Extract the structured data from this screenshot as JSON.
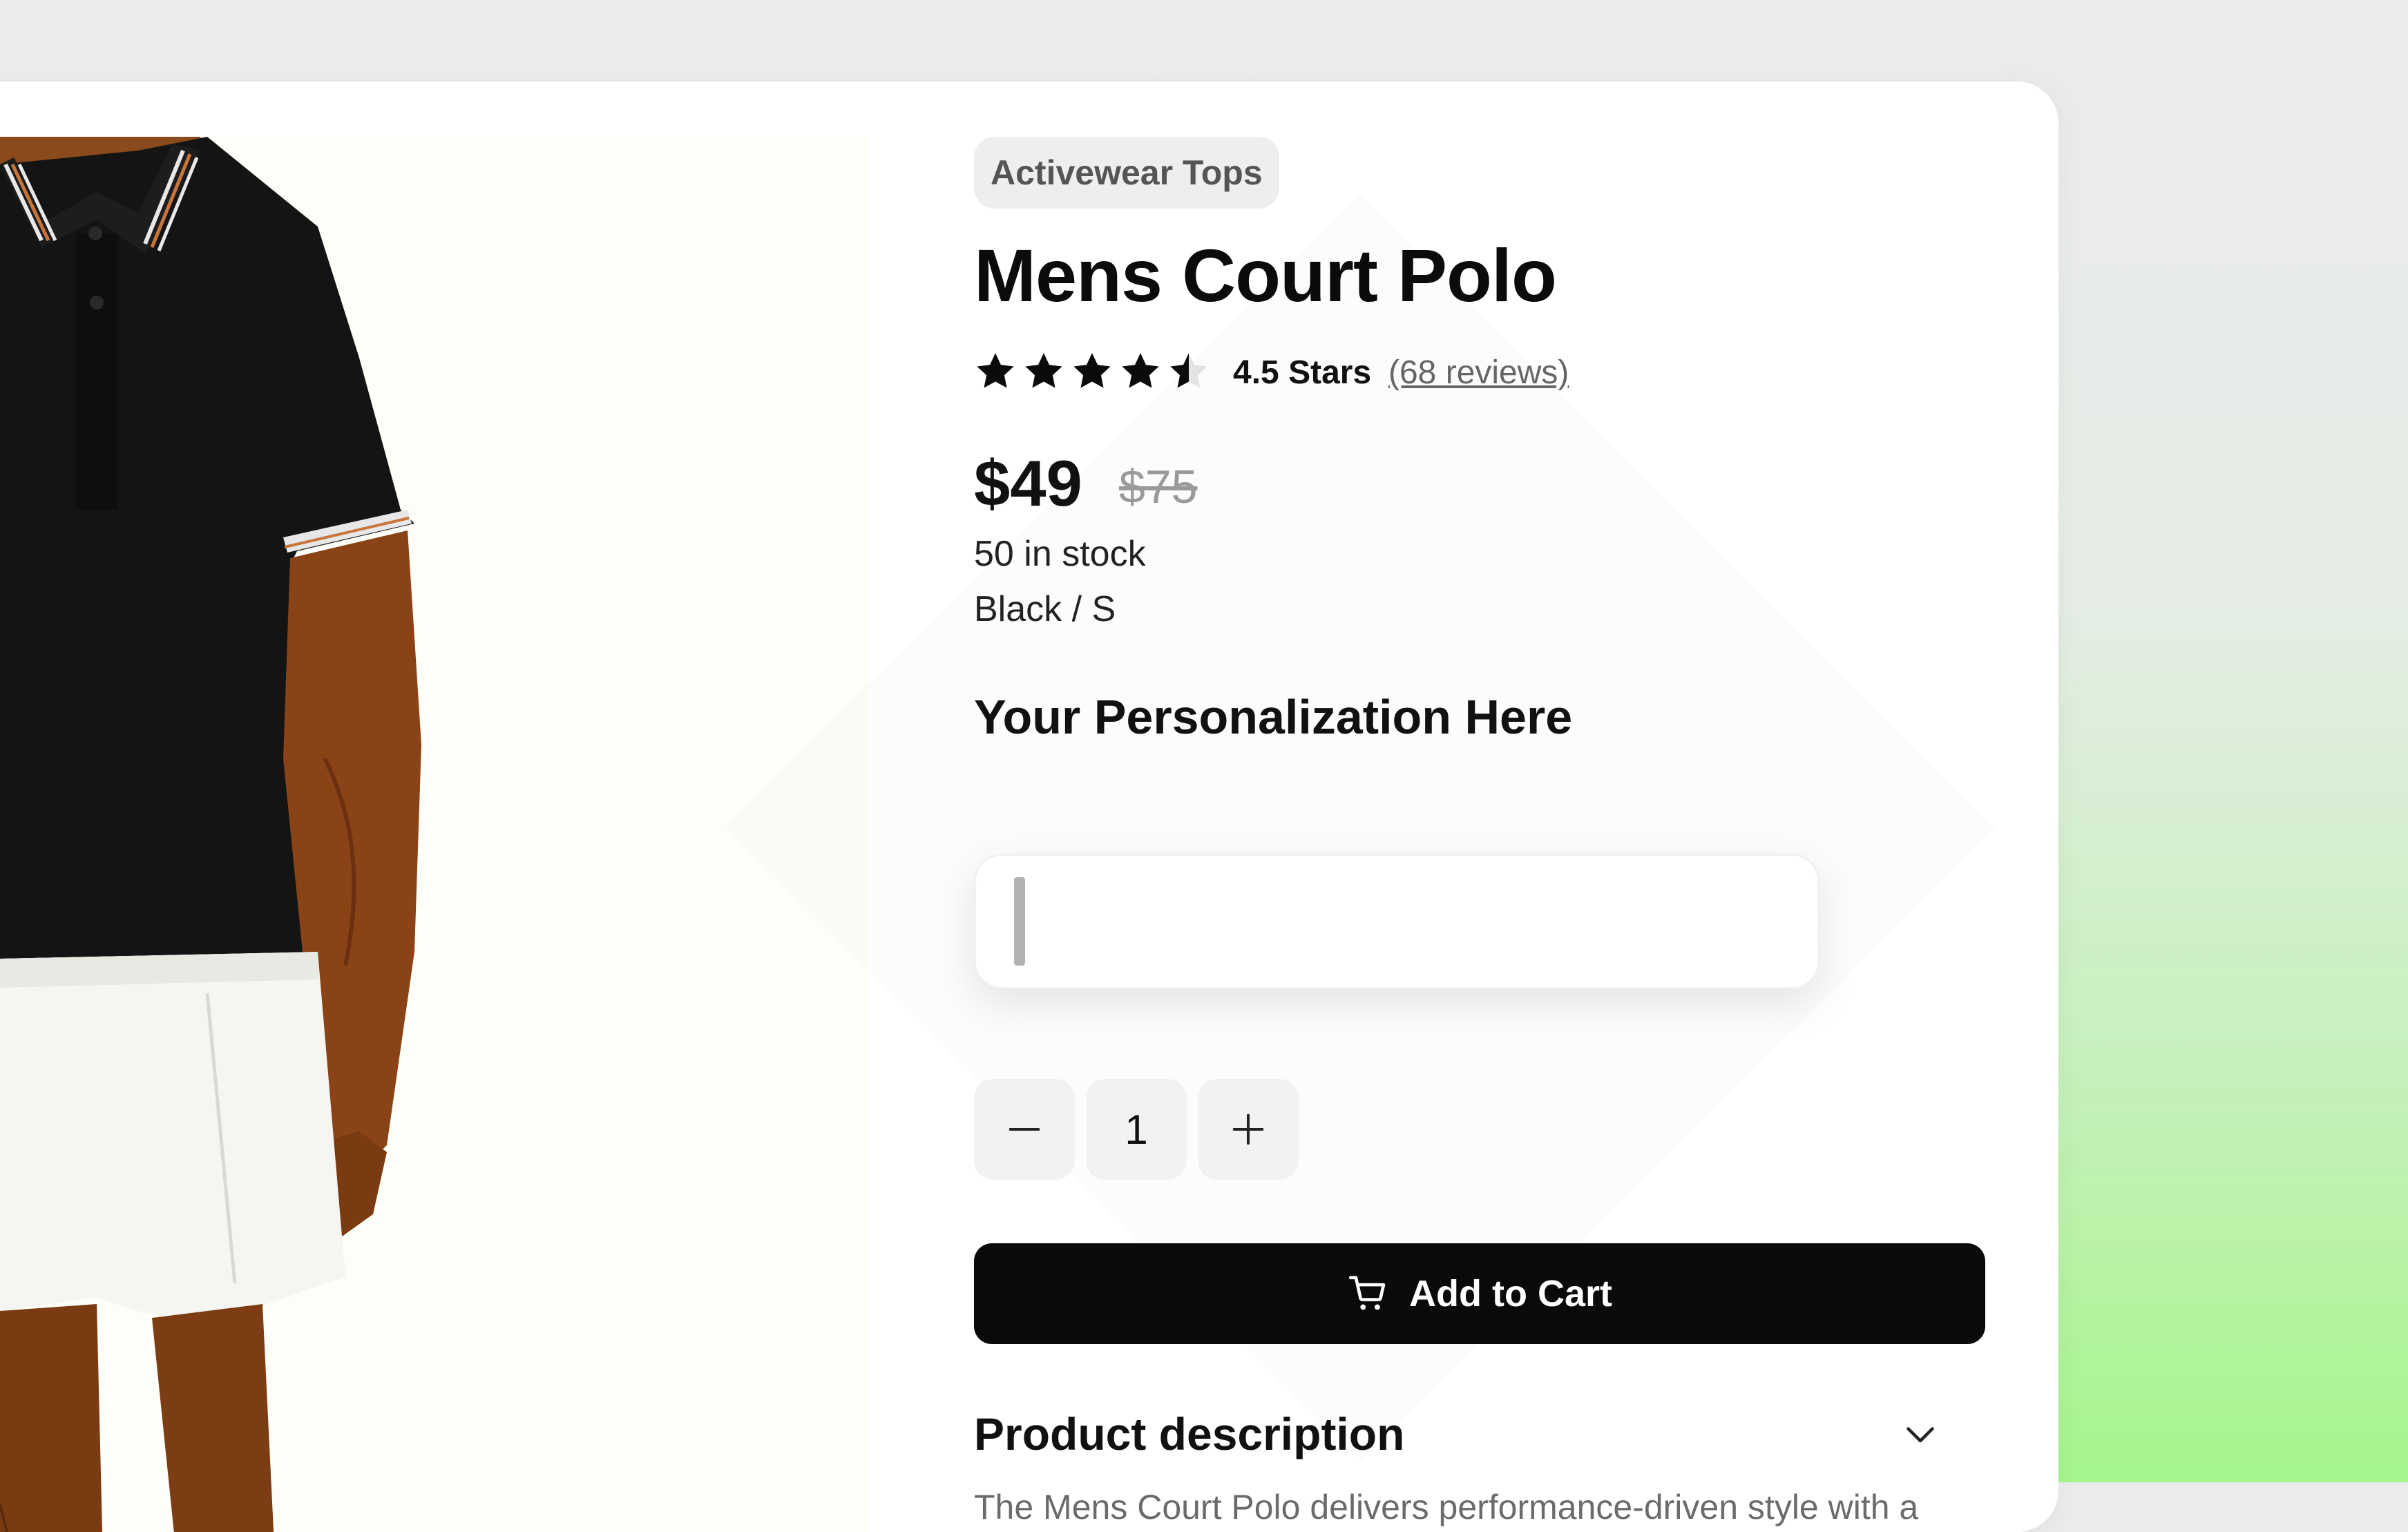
{
  "product": {
    "category": "Activewear Tops",
    "title": "Mens Court Polo",
    "rating_value": 4.5,
    "rating_max": 5,
    "rating_text": "4.5 Stars",
    "reviews_link": "(68 reviews)",
    "price": "$49",
    "original_price": "$75",
    "stock": "50 in stock",
    "variant": "Black / S",
    "image_icon": "polo-shirt-model-photo"
  },
  "personalization": {
    "label": "Your Personalization Here",
    "value": "",
    "placeholder": ""
  },
  "quantity": {
    "decrement_icon": "minus-icon",
    "value": "1",
    "increment_icon": "plus-icon"
  },
  "cart_button": {
    "label": "Add to Cart",
    "icon": "cart-icon"
  },
  "description": {
    "title": "Product description",
    "toggle_icon": "chevron-down-icon",
    "text": "The Mens Court Polo delivers performance-driven style with a tailored fit designed for active movement. Available in multiple"
  },
  "colors": {
    "button_bg": "#0a0a0a",
    "badge_bg": "#eeeeee",
    "image_bg": "#fdfef7",
    "accent_green": "#a6f58c"
  }
}
